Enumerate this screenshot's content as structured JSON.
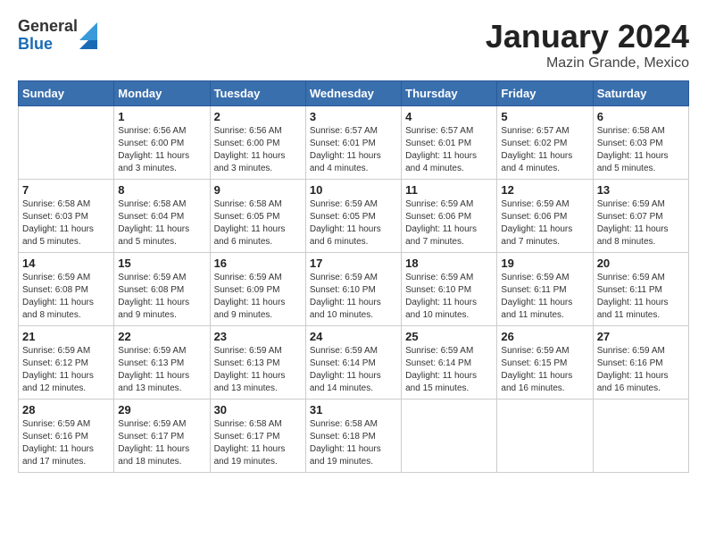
{
  "header": {
    "logo_general": "General",
    "logo_blue": "Blue",
    "month_title": "January 2024",
    "location": "Mazin Grande, Mexico"
  },
  "calendar": {
    "days_of_week": [
      "Sunday",
      "Monday",
      "Tuesday",
      "Wednesday",
      "Thursday",
      "Friday",
      "Saturday"
    ],
    "weeks": [
      [
        {
          "day": "",
          "sunrise": "",
          "sunset": "",
          "daylight": ""
        },
        {
          "day": "1",
          "sunrise": "6:56 AM",
          "sunset": "6:00 PM",
          "daylight": "11 hours and 3 minutes."
        },
        {
          "day": "2",
          "sunrise": "6:56 AM",
          "sunset": "6:00 PM",
          "daylight": "11 hours and 3 minutes."
        },
        {
          "day": "3",
          "sunrise": "6:57 AM",
          "sunset": "6:01 PM",
          "daylight": "11 hours and 4 minutes."
        },
        {
          "day": "4",
          "sunrise": "6:57 AM",
          "sunset": "6:01 PM",
          "daylight": "11 hours and 4 minutes."
        },
        {
          "day": "5",
          "sunrise": "6:57 AM",
          "sunset": "6:02 PM",
          "daylight": "11 hours and 4 minutes."
        },
        {
          "day": "6",
          "sunrise": "6:58 AM",
          "sunset": "6:03 PM",
          "daylight": "11 hours and 5 minutes."
        }
      ],
      [
        {
          "day": "7",
          "sunrise": "6:58 AM",
          "sunset": "6:03 PM",
          "daylight": "11 hours and 5 minutes."
        },
        {
          "day": "8",
          "sunrise": "6:58 AM",
          "sunset": "6:04 PM",
          "daylight": "11 hours and 5 minutes."
        },
        {
          "day": "9",
          "sunrise": "6:58 AM",
          "sunset": "6:05 PM",
          "daylight": "11 hours and 6 minutes."
        },
        {
          "day": "10",
          "sunrise": "6:59 AM",
          "sunset": "6:05 PM",
          "daylight": "11 hours and 6 minutes."
        },
        {
          "day": "11",
          "sunrise": "6:59 AM",
          "sunset": "6:06 PM",
          "daylight": "11 hours and 7 minutes."
        },
        {
          "day": "12",
          "sunrise": "6:59 AM",
          "sunset": "6:06 PM",
          "daylight": "11 hours and 7 minutes."
        },
        {
          "day": "13",
          "sunrise": "6:59 AM",
          "sunset": "6:07 PM",
          "daylight": "11 hours and 8 minutes."
        }
      ],
      [
        {
          "day": "14",
          "sunrise": "6:59 AM",
          "sunset": "6:08 PM",
          "daylight": "11 hours and 8 minutes."
        },
        {
          "day": "15",
          "sunrise": "6:59 AM",
          "sunset": "6:08 PM",
          "daylight": "11 hours and 9 minutes."
        },
        {
          "day": "16",
          "sunrise": "6:59 AM",
          "sunset": "6:09 PM",
          "daylight": "11 hours and 9 minutes."
        },
        {
          "day": "17",
          "sunrise": "6:59 AM",
          "sunset": "6:10 PM",
          "daylight": "11 hours and 10 minutes."
        },
        {
          "day": "18",
          "sunrise": "6:59 AM",
          "sunset": "6:10 PM",
          "daylight": "11 hours and 10 minutes."
        },
        {
          "day": "19",
          "sunrise": "6:59 AM",
          "sunset": "6:11 PM",
          "daylight": "11 hours and 11 minutes."
        },
        {
          "day": "20",
          "sunrise": "6:59 AM",
          "sunset": "6:11 PM",
          "daylight": "11 hours and 11 minutes."
        }
      ],
      [
        {
          "day": "21",
          "sunrise": "6:59 AM",
          "sunset": "6:12 PM",
          "daylight": "11 hours and 12 minutes."
        },
        {
          "day": "22",
          "sunrise": "6:59 AM",
          "sunset": "6:13 PM",
          "daylight": "11 hours and 13 minutes."
        },
        {
          "day": "23",
          "sunrise": "6:59 AM",
          "sunset": "6:13 PM",
          "daylight": "11 hours and 13 minutes."
        },
        {
          "day": "24",
          "sunrise": "6:59 AM",
          "sunset": "6:14 PM",
          "daylight": "11 hours and 14 minutes."
        },
        {
          "day": "25",
          "sunrise": "6:59 AM",
          "sunset": "6:14 PM",
          "daylight": "11 hours and 15 minutes."
        },
        {
          "day": "26",
          "sunrise": "6:59 AM",
          "sunset": "6:15 PM",
          "daylight": "11 hours and 16 minutes."
        },
        {
          "day": "27",
          "sunrise": "6:59 AM",
          "sunset": "6:16 PM",
          "daylight": "11 hours and 16 minutes."
        }
      ],
      [
        {
          "day": "28",
          "sunrise": "6:59 AM",
          "sunset": "6:16 PM",
          "daylight": "11 hours and 17 minutes."
        },
        {
          "day": "29",
          "sunrise": "6:59 AM",
          "sunset": "6:17 PM",
          "daylight": "11 hours and 18 minutes."
        },
        {
          "day": "30",
          "sunrise": "6:58 AM",
          "sunset": "6:17 PM",
          "daylight": "11 hours and 19 minutes."
        },
        {
          "day": "31",
          "sunrise": "6:58 AM",
          "sunset": "6:18 PM",
          "daylight": "11 hours and 19 minutes."
        },
        {
          "day": "",
          "sunrise": "",
          "sunset": "",
          "daylight": ""
        },
        {
          "day": "",
          "sunrise": "",
          "sunset": "",
          "daylight": ""
        },
        {
          "day": "",
          "sunrise": "",
          "sunset": "",
          "daylight": ""
        }
      ]
    ]
  }
}
